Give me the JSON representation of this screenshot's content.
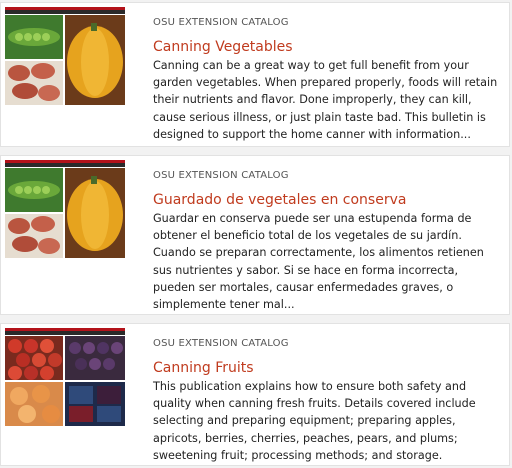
{
  "results": [
    {
      "catalog": "OSU EXTENSION CATALOG",
      "title": "Canning Vegetables",
      "description": "Canning can be a great way to get full benefit from your garden vegetables. When prepared properly, foods will retain their nutrients and flavor. Done improperly, they can kill, cause serious illness, or just plain taste bad. This bulletin is designed to support the home canner with information..."
    },
    {
      "catalog": "OSU EXTENSION CATALOG",
      "title": "Guardado de vegetales en conserva",
      "description": "Guardar en conserva puede ser una estupenda forma de obtener el beneficio total de los vegetales de su jardín. Cuando se preparan correctamente, los alimentos retienen sus nutrientes y sabor. Si se hace en forma incorrecta, pueden ser mortales, causar enfermedades graves, o simplemente tener mal..."
    },
    {
      "catalog": "OSU EXTENSION CATALOG",
      "title": "Canning Fruits",
      "description": "This publication explains how to ensure both safety and quality when canning fresh fruits. Details covered include selecting and preparing equipment; preparing apples, apricots, berries, cherries, peaches, pears, and plums; sweetening fruit; processing methods; and storage."
    }
  ],
  "colors": {
    "title": "#c03b1e",
    "banner_red": "#b3121a",
    "banner_dark": "#2a2a2a"
  },
  "icons": [
    "vegetables-cover-image",
    "vegetables-cover-image",
    "fruits-cover-image"
  ]
}
